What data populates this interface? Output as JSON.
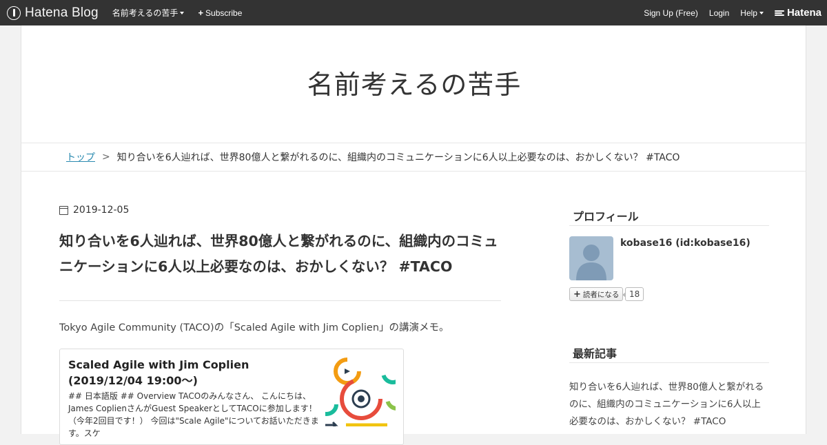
{
  "globalbar": {
    "logo_text": "Hatena Blog",
    "blog_menu_label": "名前考えるの苦手",
    "subscribe_label": "Subscribe",
    "signup_label": "Sign Up (Free)",
    "login_label": "Login",
    "help_label": "Help",
    "hatena_label": "Hatena"
  },
  "blog": {
    "title": "名前考えるの苦手"
  },
  "breadcrumb": {
    "top_label": "トップ",
    "separator": ">",
    "current": "知り合いを6人辿れば、世界80億人と繋がれるのに、組織内のコミュニケーションに6人以上必要なのは、おかしくない？ #TACO"
  },
  "article": {
    "date": "2019-12-05",
    "title": "知り合いを6人辿れば、世界80億人と繋がれるのに、組織内のコミュニケーションに6人以上必要なのは、おかしくない？ #TACO",
    "intro": "Tokyo Agile Community (TACO)の「Scaled Agile with Jim Coplien」の講演メモ。",
    "embed": {
      "title": "Scaled Agile with Jim Coplien (2019/12/04 19:00〜)",
      "description": "## 日本語版 ## Overview TACOのみんなさん、 こんにちは、 James CoplienさんがGuest SpeakerとしてTACOに参加します！（今年2回目です！） 今回は\"Scale Agile\"についてお話いただきます。スケ"
    }
  },
  "sidebar": {
    "profile_heading": "プロフィール",
    "profile_name": "kobase16 (id:kobase16)",
    "reader_button_label": "読者になる",
    "reader_count": "18",
    "recent_heading": "最新記事",
    "recent_item": "知り合いを6人辿れば、世界80億人と繋がれるのに、組織内のコミュニケーションに6人以上必要なのは、おかしくない？ #TACO"
  },
  "colors": {
    "globalbar_bg": "#333333",
    "link": "#2a8ab0",
    "page_bg": "#f2f2f2"
  },
  "icons": [
    "hatena-logo-icon",
    "caret-down-icon",
    "plus-icon",
    "calendar-icon",
    "avatar-silhouette-icon"
  ]
}
